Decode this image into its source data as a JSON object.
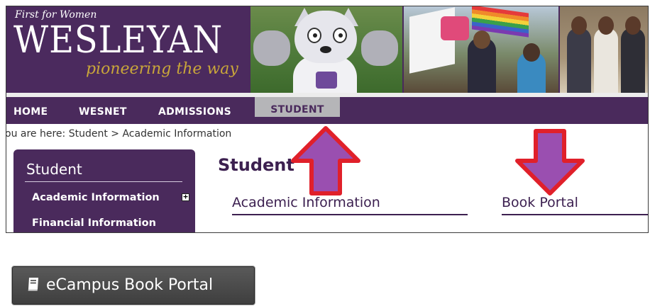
{
  "header": {
    "tagline_top": "First for Women",
    "logo_word": "WESLEYAN",
    "logo_sub": "pioneering the way"
  },
  "nav": {
    "items": [
      {
        "label": "HOME"
      },
      {
        "label": "WESNET"
      },
      {
        "label": "ADMISSIONS"
      },
      {
        "label": "STUDENT",
        "active": true
      }
    ]
  },
  "breadcrumb": {
    "prefix": "ou are here:",
    "items": [
      "Student",
      "Academic Information"
    ],
    "separator": ">"
  },
  "sidebar": {
    "title": "Student",
    "items": [
      {
        "label": "Academic Information",
        "expandable": true
      },
      {
        "label": "Financial Information"
      }
    ]
  },
  "main": {
    "title": "Student",
    "sections": [
      {
        "label": "Academic Information"
      },
      {
        "label": "Book Portal"
      }
    ]
  },
  "button": {
    "label": "eCampus Book Portal",
    "icon": "book-icon"
  },
  "colors": {
    "brand_purple": "#4a2a5c",
    "gold": "#c9a63a",
    "active_tab": "#b5b5b8",
    "arrow_outline": "#e0202a",
    "arrow_fill": "#9a4fb0"
  }
}
